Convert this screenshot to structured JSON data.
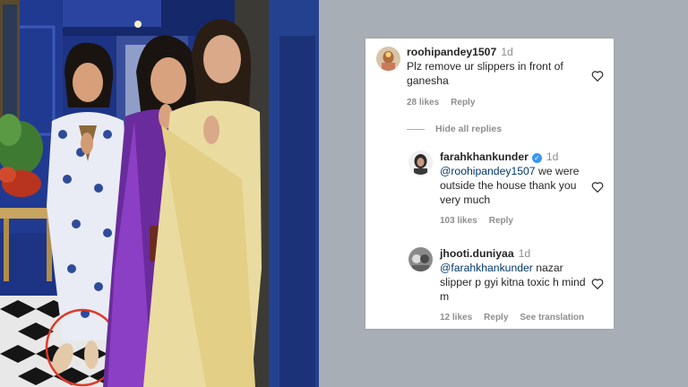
{
  "comments": [
    {
      "username": "roohipandey1507",
      "time": "1d",
      "text": "Plz remove ur slippers in front of ganesha",
      "likes": "28 likes",
      "reply_label": "Reply"
    },
    {
      "username": "farahkhankunder",
      "time": "1d",
      "mention": "@roohipandey1507",
      "text": " we were outside the house thank you very much",
      "likes": "103 likes",
      "reply_label": "Reply"
    },
    {
      "username": "jhooti.duniyaa",
      "time": "1d",
      "mention": "@farahkhankunder",
      "text": " nazar slipper p gyi kitna toxic h mind m",
      "likes": "12 likes",
      "reply_label": "Reply",
      "translation_label": "See translation"
    }
  ],
  "hide_replies_label": "Hide all replies",
  "icons": {
    "like": "heart-icon",
    "verified": "verified-badge-icon"
  },
  "colors": {
    "mention": "#00376b",
    "meta": "#8e8e8e",
    "verified": "#3897f0",
    "highlight_circle": "#e0392b"
  }
}
